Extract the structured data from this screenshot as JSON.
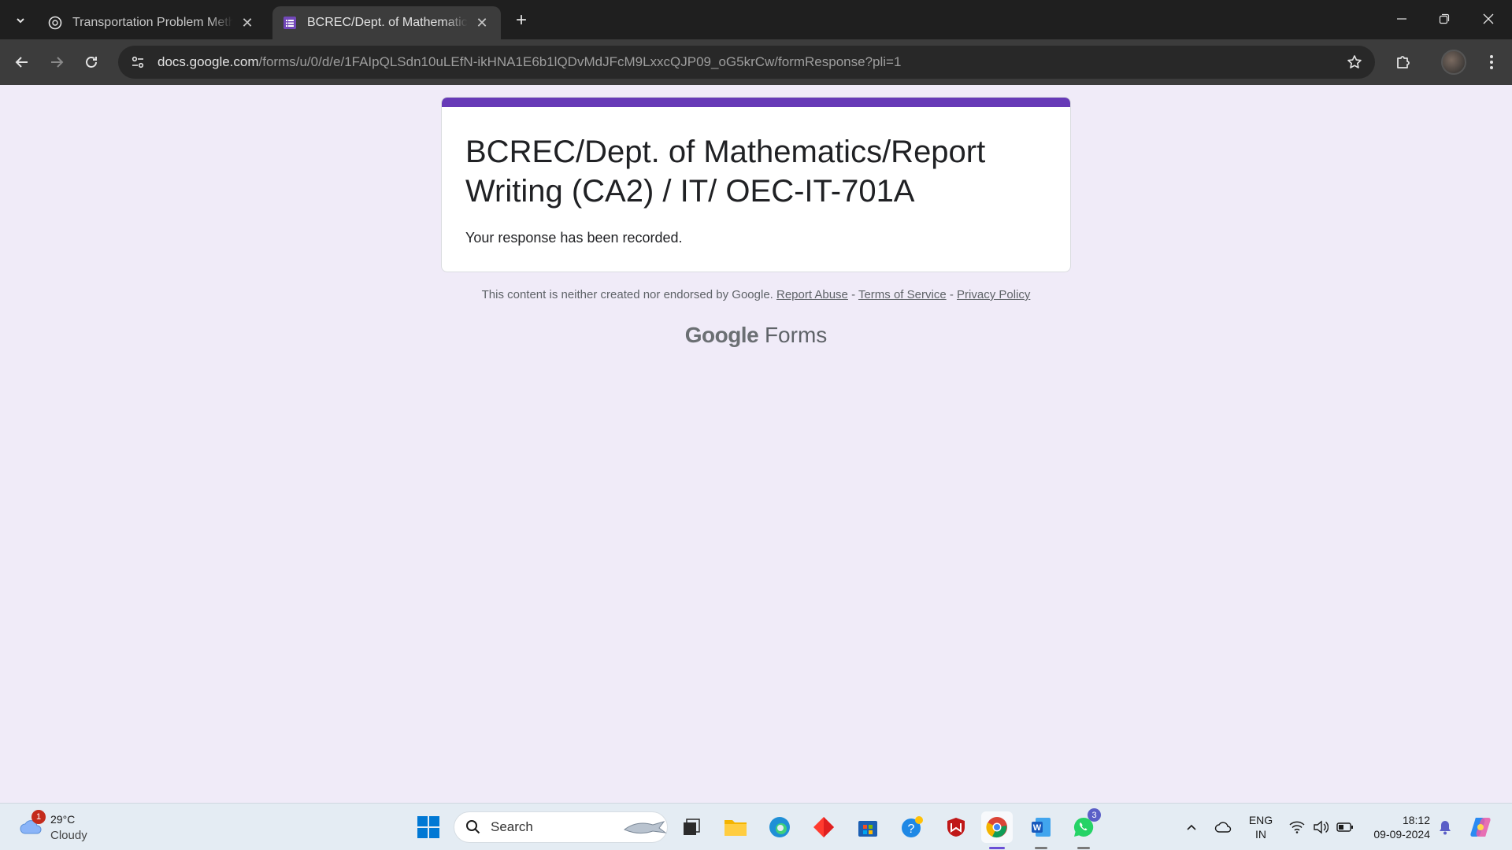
{
  "browser": {
    "tabs": [
      {
        "title": "Transportation Problem Method",
        "active": false
      },
      {
        "title": "BCREC/Dept. of Mathematics/Report Writing",
        "active": true
      }
    ],
    "new_tab": "+",
    "url_host": "docs.google.com",
    "url_path": "/forms/u/0/d/e/1FAIpQLSdn10uLEfN-ikHNA1E6b1lQDvMdJFcM9LxxcQJP09_oG5krCw/formResponse?pli=1"
  },
  "form": {
    "title": "BCREC/Dept. of Mathematics/Report Writing (CA2) / IT/ OEC-IT-701A",
    "message": "Your response has been recorded.",
    "accent_color": "#673ab7"
  },
  "footer": {
    "note": "This content is neither created nor endorsed by Google.",
    "report_abuse": "Report Abuse",
    "sep1": " - ",
    "terms": "Terms of Service",
    "sep2": " - ",
    "privacy": "Privacy Policy",
    "brand_google": "Google",
    "brand_forms": "Forms"
  },
  "taskbar": {
    "weather_badge": "1",
    "weather_temp": "29°C",
    "weather_cond": "Cloudy",
    "search_label": "Search",
    "whatsapp_badge": "3",
    "lang_line1": "ENG",
    "lang_line2": "IN",
    "time": "18:12",
    "date": "09-09-2024"
  }
}
